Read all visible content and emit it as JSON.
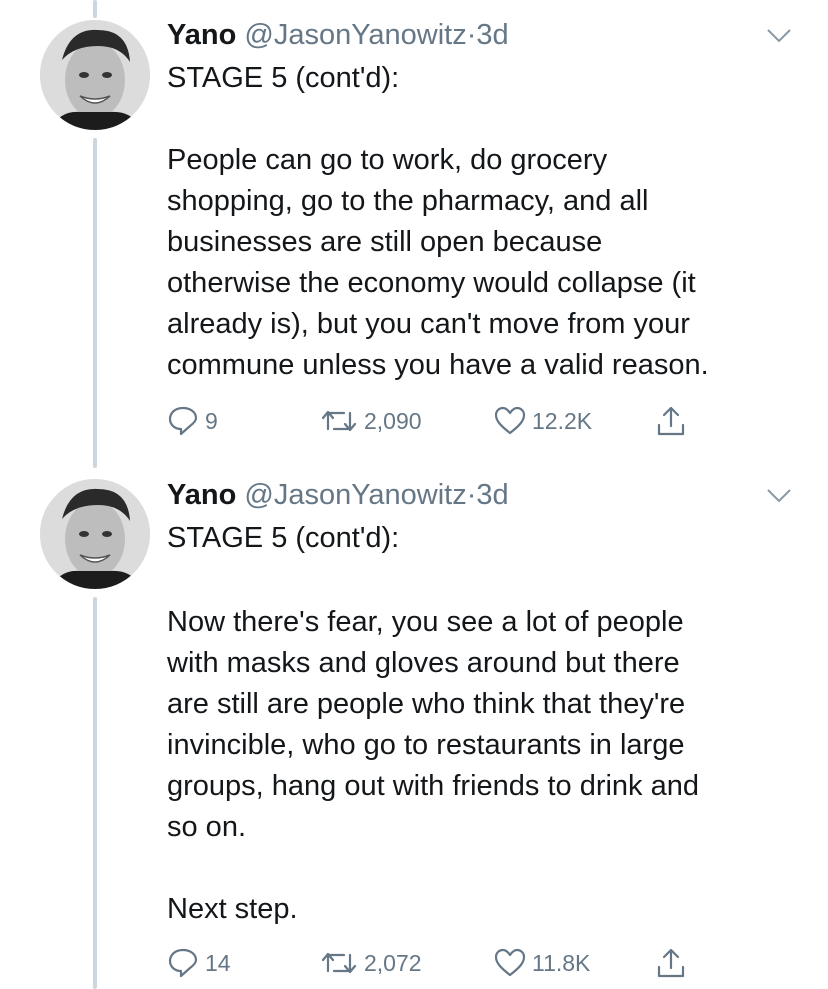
{
  "tweets": [
    {
      "name": "Yano",
      "handle": "@JasonYanowitz",
      "separator": "·",
      "time": "3d",
      "heading": "STAGE 5 (cont'd):",
      "body": "People can go to work, do grocery\nshopping, go to the pharmacy, and all\nbusinesses are still open because\notherwise the economy would collapse (it\nalready is), but you can't move from your\ncommune unless you have a valid reason.",
      "replies": "9",
      "retweets": "2,090",
      "likes": "12.2K"
    },
    {
      "name": "Yano",
      "handle": "@JasonYanowitz",
      "separator": "·",
      "time": "3d",
      "heading": "STAGE 5 (cont'd):",
      "body": "Now there's fear, you see a lot of people\nwith masks and gloves around but there\nare still are people who think that they're\ninvincible, who go to restaurants in large\ngroups, hang out with friends to drink and\nso on.\n\nNext step.",
      "replies": "14",
      "retweets": "2,072",
      "likes": "11.8K"
    }
  ],
  "icons": [
    "reply-icon",
    "retweet-icon",
    "like-icon",
    "share-icon",
    "chevron-down-icon"
  ],
  "colors": {
    "text": "#14171a",
    "secondary": "#657786",
    "thread_line": "#ccd6dd"
  }
}
